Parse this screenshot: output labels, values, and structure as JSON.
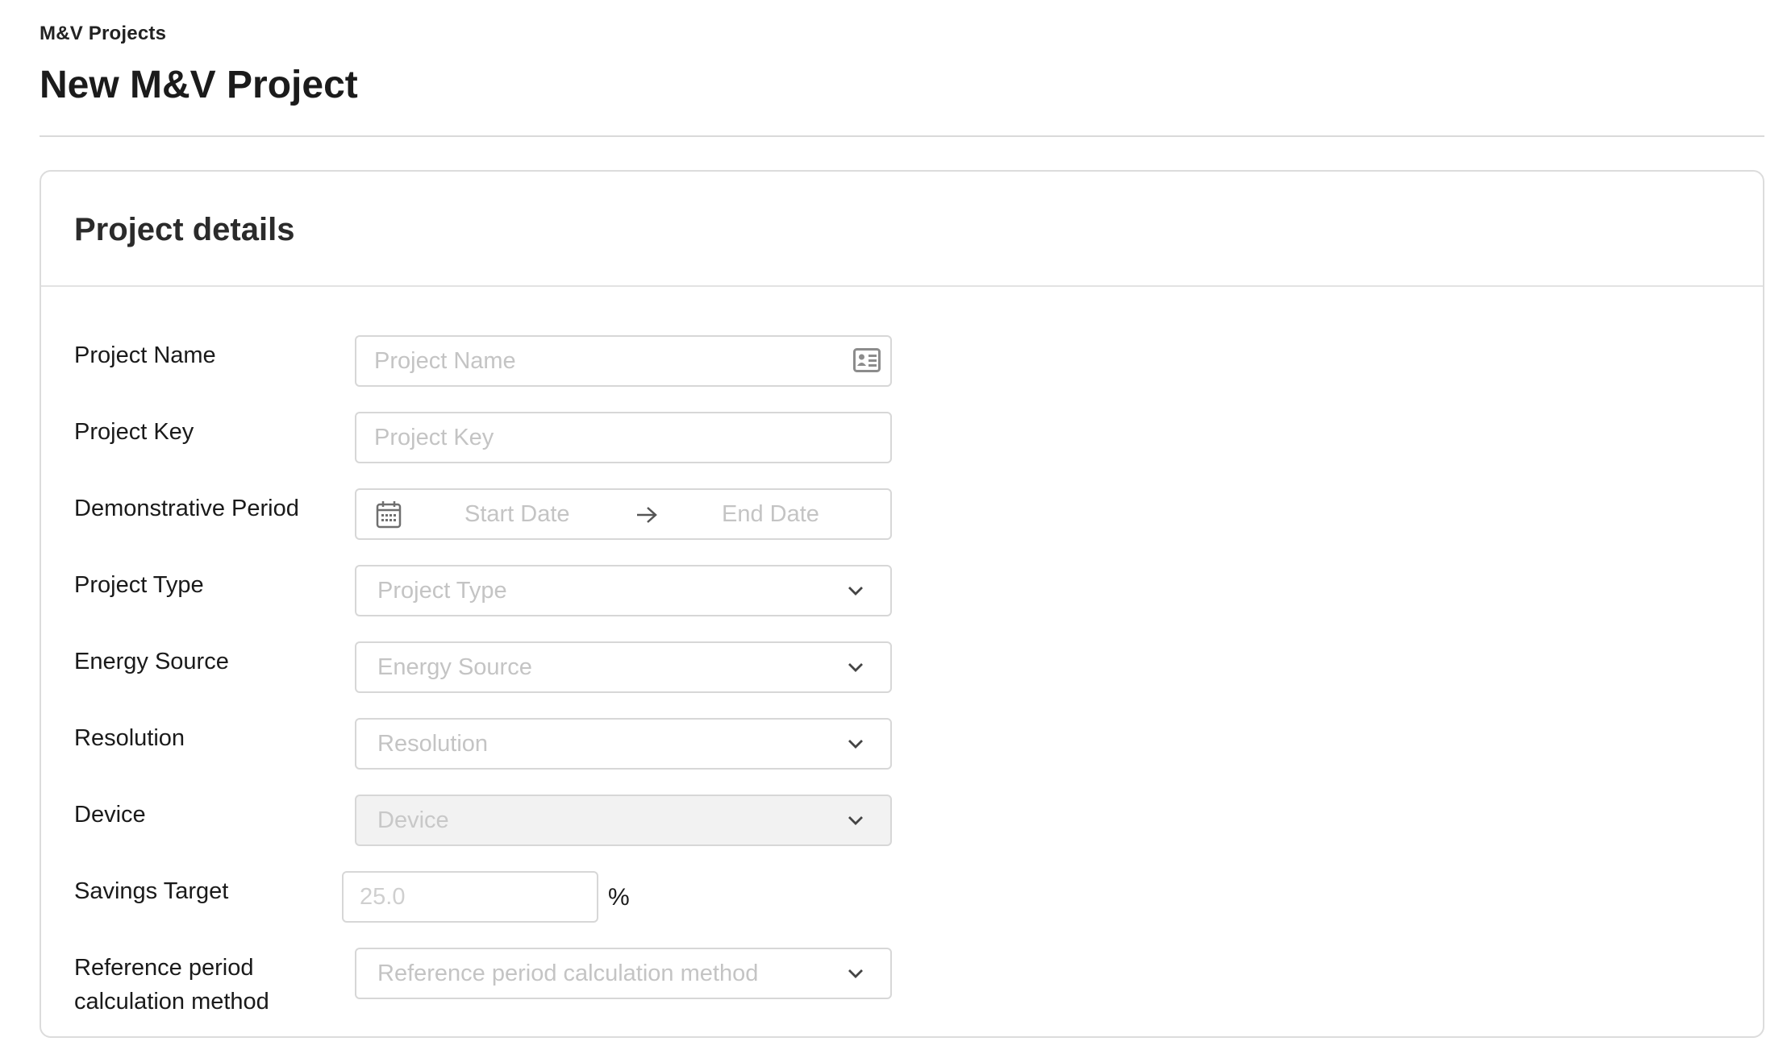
{
  "breadcrumb": "M&V Projects",
  "page_title": "New M&V Project",
  "card": {
    "title": "Project details"
  },
  "fields": {
    "project_name": {
      "label": "Project Name",
      "placeholder": "Project Name",
      "icon": "contact-card-icon"
    },
    "project_key": {
      "label": "Project Key",
      "placeholder": "Project Key"
    },
    "demonstrative_period": {
      "label": "Demonstrative Period",
      "start_placeholder": "Start Date",
      "end_placeholder": "End Date",
      "icon": "calendar-icon"
    },
    "project_type": {
      "label": "Project Type",
      "placeholder": "Project Type"
    },
    "energy_source": {
      "label": "Energy Source",
      "placeholder": "Energy Source"
    },
    "resolution": {
      "label": "Resolution",
      "placeholder": "Resolution"
    },
    "device": {
      "label": "Device",
      "placeholder": "Device",
      "disabled": true
    },
    "savings_target": {
      "label": "Savings Target",
      "placeholder": "25.0",
      "unit": "%"
    },
    "reference_period": {
      "label_line1": "Reference period",
      "label_line2": "calculation method",
      "placeholder": "Reference period calculation method"
    }
  }
}
